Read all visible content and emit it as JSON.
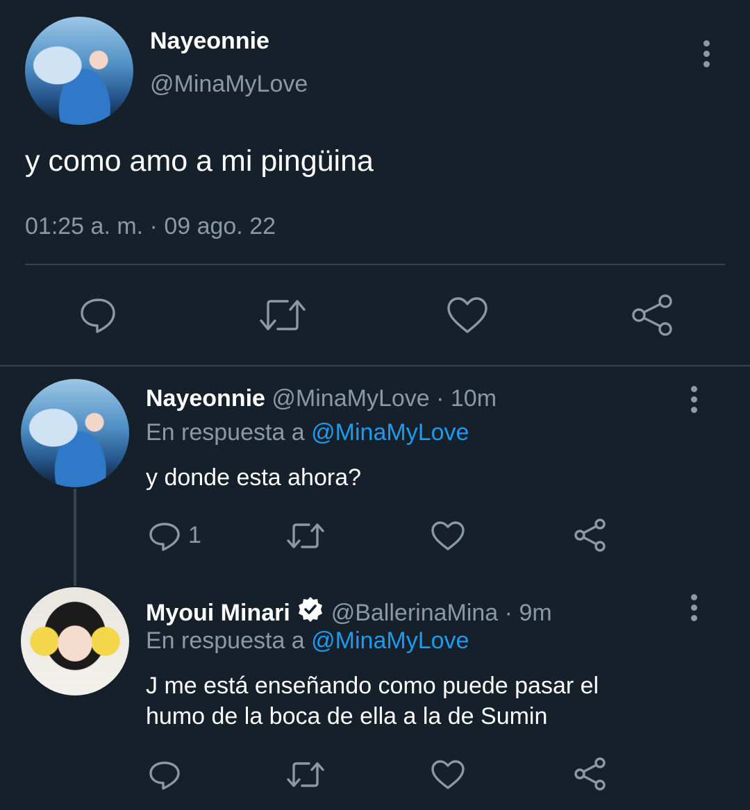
{
  "main_tweet": {
    "author_name": "Nayeonnie",
    "author_handle": "@MinaMyLove",
    "text": "y como amo a mi pingüina",
    "timestamp": "01:25 a. m. · 09 ago. 22",
    "actions": [
      "reply-icon",
      "retweet-icon",
      "like-icon",
      "share-icon"
    ]
  },
  "replies": [
    {
      "author_name": "Nayeonnie",
      "author_handle": "@MinaMyLove",
      "time": "· 10m",
      "reply_to_label": "En respuesta a",
      "reply_to_handle": "@MinaMyLove",
      "text": "y donde esta ahora?",
      "reply_count": "1",
      "verified": false
    },
    {
      "author_name": "Myoui Minari",
      "author_handle": "@BallerinaMina",
      "time": "· 9m",
      "reply_to_label": "En respuesta a",
      "reply_to_handle": "@MinaMyLove",
      "text_line1": "J me está enseñando como puede pasar el",
      "text_line2": "humo de la boca de ella a la de Sumin",
      "reply_count": "",
      "verified": true
    }
  ],
  "colors": {
    "background": "#15202b",
    "text_primary": "#ffffff",
    "text_secondary": "#8b98a5",
    "accent": "#1d9bf0",
    "divider": "#38444d"
  }
}
